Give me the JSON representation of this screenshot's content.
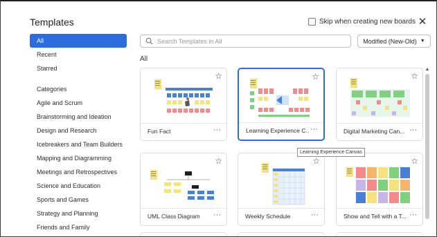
{
  "dialog": {
    "title": "Templates",
    "skip_label": "Skip when creating new boards",
    "close_glyph": "✕"
  },
  "sidebar": {
    "top_items": [
      {
        "label": "All",
        "active": true
      },
      {
        "label": "Recent",
        "active": false
      },
      {
        "label": "Starred",
        "active": false
      }
    ],
    "category_items": [
      {
        "label": "Categories"
      },
      {
        "label": "Agile and Scrum"
      },
      {
        "label": "Brainstorming and Ideation"
      },
      {
        "label": "Design and Research"
      },
      {
        "label": "Icebreakers and Team Builders"
      },
      {
        "label": "Mapping and Diagramming"
      },
      {
        "label": "Meetings and Retrospectives"
      },
      {
        "label": "Science and Education"
      },
      {
        "label": "Sports and Games"
      },
      {
        "label": "Strategy and Planning"
      },
      {
        "label": "Friends and Family"
      }
    ]
  },
  "search": {
    "placeholder": "Search Templates in All"
  },
  "sort": {
    "label": "Modified (New-Old)"
  },
  "section_label": "All",
  "cards": [
    {
      "name": "Fun Fact"
    },
    {
      "name": "Learning Experience C..."
    },
    {
      "name": "Digital Marketing Can..."
    },
    {
      "name": "UML Class Diagram"
    },
    {
      "name": "Weekly Schedule"
    },
    {
      "name": "Show and Tell with a T..."
    }
  ],
  "tooltip": {
    "text": "Learning Experience Canvas"
  },
  "more_glyph": "···",
  "star_glyph": "☆",
  "colors": {
    "accent": "#2d6cdf",
    "sticky_yellow": "#f5e27a",
    "sticky_pink": "#f58a8a",
    "sticky_green": "#7fd07f",
    "sticky_blue": "#4a7fd8"
  }
}
